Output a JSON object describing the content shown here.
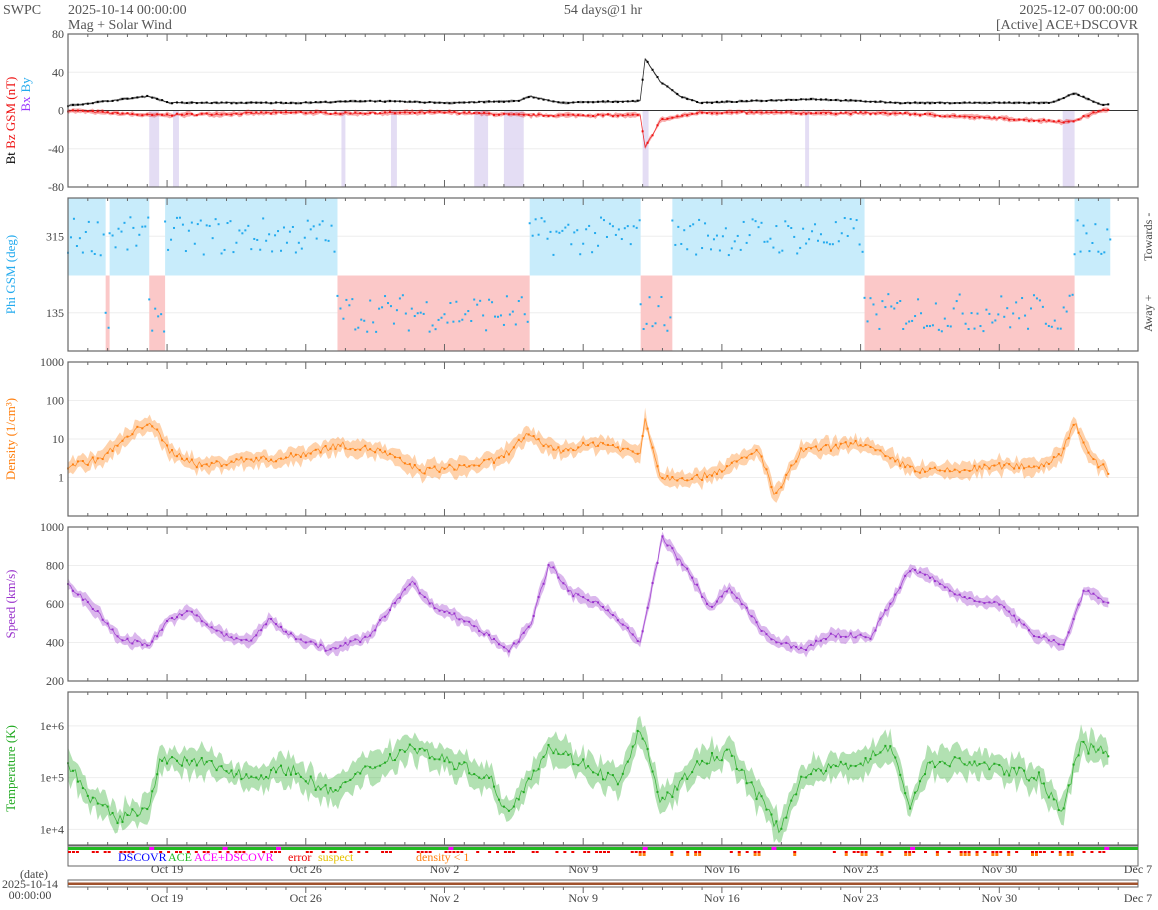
{
  "header": {
    "org": "SWPC",
    "start": "2025-10-14 00:00:00",
    "subtitle": "Mag + Solar Wind",
    "span": "54 days@1 hr",
    "end": "2025-12-07 00:00:00",
    "source": "[Active] ACE+DSCOVR"
  },
  "colors": {
    "bt": "#000000",
    "bz": "#ee1111",
    "bx": "#9933ff",
    "by": "#22aaee",
    "phi": "#22aaee",
    "density": "#ff7f0e",
    "speed": "#9932cc",
    "temperature": "#22aa22",
    "towards": "#c8ecfb",
    "away": "#fbc8c8"
  },
  "chart_data": [
    {
      "type": "line",
      "title": "Mag",
      "ylabel_parts": [
        "Bt",
        "Bz GSM (nT)",
        "Bx",
        "By"
      ],
      "ylim": [
        -80,
        80
      ],
      "yticks": [
        "80",
        "40",
        "0",
        "-40",
        "-80"
      ],
      "series": [
        {
          "name": "Bt",
          "points": [
            [
              0,
              5
            ],
            [
              4.1,
              15
            ],
            [
              5.1,
              8
            ],
            [
              11.7,
              8
            ],
            [
              15.2,
              10
            ],
            [
              19.3,
              8
            ],
            [
              22.8,
              10
            ],
            [
              23.3,
              15
            ],
            [
              24.8,
              8
            ],
            [
              28.9,
              10
            ],
            [
              29.1,
              55
            ],
            [
              29.9,
              30
            ],
            [
              30.9,
              15
            ],
            [
              31.9,
              8
            ],
            [
              37.5,
              12
            ],
            [
              42.0,
              8
            ],
            [
              49.6,
              8
            ],
            [
              50.8,
              18
            ],
            [
              52.1,
              6
            ],
            [
              52.5,
              6
            ]
          ]
        },
        {
          "name": "Bz GSM",
          "points": [
            [
              0,
              0
            ],
            [
              4.1,
              -5
            ],
            [
              11.7,
              -2
            ],
            [
              13.7,
              -3
            ],
            [
              19.3,
              -2
            ],
            [
              23.1,
              -5
            ],
            [
              28.9,
              -5
            ],
            [
              29.1,
              -40
            ],
            [
              29.9,
              -10
            ],
            [
              31.9,
              -2
            ],
            [
              42.0,
              -3
            ],
            [
              50.6,
              -12
            ],
            [
              52.1,
              0
            ],
            [
              52.5,
              0
            ]
          ]
        }
      ]
    },
    {
      "type": "scatter",
      "title": "Phi",
      "ylabel": "Phi GSM (deg)",
      "yticks": [
        "315",
        "135"
      ],
      "ylim": [
        45,
        405
      ],
      "right_labels": [
        "Towards -",
        "Away +"
      ],
      "sectors": [
        {
          "dir": "towards",
          "start": 0,
          "end": 1.9
        },
        {
          "dir": "away",
          "start": 1.9,
          "end": 2.1
        },
        {
          "dir": "towards",
          "start": 2.1,
          "end": 4.1
        },
        {
          "dir": "away",
          "start": 4.1,
          "end": 4.9
        },
        {
          "dir": "towards",
          "start": 4.9,
          "end": 13.6
        },
        {
          "dir": "away",
          "start": 13.6,
          "end": 23.3
        },
        {
          "dir": "towards",
          "start": 23.3,
          "end": 28.9
        },
        {
          "dir": "away",
          "start": 28.9,
          "end": 30.5
        },
        {
          "dir": "towards",
          "start": 30.5,
          "end": 40.2
        },
        {
          "dir": "away",
          "start": 40.2,
          "end": 50.8
        },
        {
          "dir": "towards",
          "start": 50.8,
          "end": 52.6
        }
      ]
    },
    {
      "type": "line",
      "title": "Density",
      "ylabel": "Density (1/cm³)",
      "scale": "log",
      "ylim": [
        0.1,
        1000
      ],
      "yticks": [
        "1000",
        "100",
        "10",
        "1"
      ],
      "series": [
        {
          "name": "Density",
          "points": [
            [
              0,
              2
            ],
            [
              1.6,
              3
            ],
            [
              3.1,
              12
            ],
            [
              4.1,
              30
            ],
            [
              5.1,
              5
            ],
            [
              6.7,
              2
            ],
            [
              9.2,
              3
            ],
            [
              10.7,
              3
            ],
            [
              11.7,
              4
            ],
            [
              13.7,
              7
            ],
            [
              15.7,
              5
            ],
            [
              17.8,
              1.5
            ],
            [
              20.3,
              2
            ],
            [
              21.8,
              3
            ],
            [
              23.1,
              12
            ],
            [
              24.8,
              5
            ],
            [
              26.9,
              8
            ],
            [
              28.9,
              4
            ],
            [
              29.1,
              40
            ],
            [
              29.9,
              1
            ],
            [
              31.9,
              1
            ],
            [
              33.4,
              2
            ],
            [
              34.9,
              5
            ],
            [
              35.7,
              0.3
            ],
            [
              37.0,
              5
            ],
            [
              38.5,
              6
            ],
            [
              40.0,
              8
            ],
            [
              41.5,
              3
            ],
            [
              43.0,
              1.5
            ],
            [
              45.0,
              1.5
            ],
            [
              47.0,
              2
            ],
            [
              49.1,
              2
            ],
            [
              50.1,
              4
            ],
            [
              50.8,
              30
            ],
            [
              51.6,
              3
            ],
            [
              52.5,
              1.5
            ]
          ]
        }
      ]
    },
    {
      "type": "line",
      "title": "Speed",
      "ylabel": "Speed (km/s)",
      "ylim": [
        200,
        1000
      ],
      "yticks": [
        "1000",
        "800",
        "600",
        "400",
        "200"
      ],
      "series": [
        {
          "name": "Speed",
          "points": [
            [
              0,
              700
            ],
            [
              1.1,
              600
            ],
            [
              2.6,
              420
            ],
            [
              4.1,
              390
            ],
            [
              5.1,
              520
            ],
            [
              6.2,
              560
            ],
            [
              7.2,
              480
            ],
            [
              8.2,
              420
            ],
            [
              9.2,
              410
            ],
            [
              10.2,
              520
            ],
            [
              11.2,
              440
            ],
            [
              13.2,
              360
            ],
            [
              15.2,
              430
            ],
            [
              17.3,
              720
            ],
            [
              18.3,
              600
            ],
            [
              20.3,
              500
            ],
            [
              22.3,
              360
            ],
            [
              23.3,
              480
            ],
            [
              24.3,
              810
            ],
            [
              25.3,
              660
            ],
            [
              26.9,
              600
            ],
            [
              28.9,
              400
            ],
            [
              30.0,
              950
            ],
            [
              31.4,
              750
            ],
            [
              32.4,
              580
            ],
            [
              33.4,
              680
            ],
            [
              35.4,
              420
            ],
            [
              37.0,
              360
            ],
            [
              38.5,
              440
            ],
            [
              40.5,
              430
            ],
            [
              41.5,
              600
            ],
            [
              42.5,
              780
            ],
            [
              43.5,
              740
            ],
            [
              45.0,
              640
            ],
            [
              47.0,
              600
            ],
            [
              48.6,
              450
            ],
            [
              50.3,
              390
            ],
            [
              51.3,
              680
            ],
            [
              52.5,
              600
            ]
          ]
        }
      ]
    },
    {
      "type": "line",
      "title": "Temperature",
      "ylabel": "Temperature (K)",
      "scale": "log",
      "ylim": [
        5000,
        4500000
      ],
      "yticks": [
        "1e+6",
        "1e+5",
        "1e+4"
      ],
      "series": [
        {
          "name": "Temperature",
          "points": [
            [
              0,
              200000
            ],
            [
              1.1,
              40000
            ],
            [
              2.6,
              15000
            ],
            [
              4.1,
              30000
            ],
            [
              4.6,
              200000
            ],
            [
              6.7,
              200000
            ],
            [
              9.2,
              100000
            ],
            [
              11.2,
              150000
            ],
            [
              13.2,
              50000
            ],
            [
              15.2,
              150000
            ],
            [
              17.3,
              400000
            ],
            [
              19.3,
              200000
            ],
            [
              21.3,
              100000
            ],
            [
              22.1,
              20000
            ],
            [
              23.3,
              100000
            ],
            [
              24.3,
              400000
            ],
            [
              25.8,
              200000
            ],
            [
              27.9,
              80000
            ],
            [
              28.9,
              1000000
            ],
            [
              29.9,
              30000
            ],
            [
              31.9,
              200000
            ],
            [
              33.4,
              300000
            ],
            [
              34.9,
              40000
            ],
            [
              35.9,
              10000
            ],
            [
              37.0,
              100000
            ],
            [
              38.5,
              150000
            ],
            [
              40.0,
              200000
            ],
            [
              41.5,
              400000
            ],
            [
              42.5,
              30000
            ],
            [
              43.5,
              200000
            ],
            [
              45.5,
              200000
            ],
            [
              47.0,
              150000
            ],
            [
              49.1,
              100000
            ],
            [
              50.1,
              20000
            ],
            [
              51.1,
              400000
            ],
            [
              52.5,
              300000
            ]
          ]
        }
      ]
    }
  ],
  "status_legend": [
    {
      "label": "DSCOVR",
      "color": "#0000ff"
    },
    {
      "label": "ACE",
      "color": "#22bb22"
    },
    {
      "label": "ACE+DSCOVR",
      "color": "#ff00ff"
    },
    {
      "label": "error",
      "color": "#ee0000"
    },
    {
      "label": "suspect",
      "color": "#e6c200"
    },
    {
      "label": "density < 1",
      "color": "#ff7f0e"
    }
  ],
  "xaxis": {
    "ticks": [
      {
        "day": 5,
        "label": "Oct 19"
      },
      {
        "day": 12,
        "label": "Oct 26"
      },
      {
        "day": 19,
        "label": "Nov 2"
      },
      {
        "day": 26,
        "label": "Nov 9"
      },
      {
        "day": 33,
        "label": "Nov 16"
      },
      {
        "day": 40,
        "label": "Nov 23"
      },
      {
        "day": 47,
        "label": "Nov 30"
      },
      {
        "day": 54,
        "label": "Dec 7"
      }
    ],
    "total_days": 54,
    "date_label": "(date)",
    "start_date": "2025-10-14",
    "start_time": "00:00:00"
  }
}
